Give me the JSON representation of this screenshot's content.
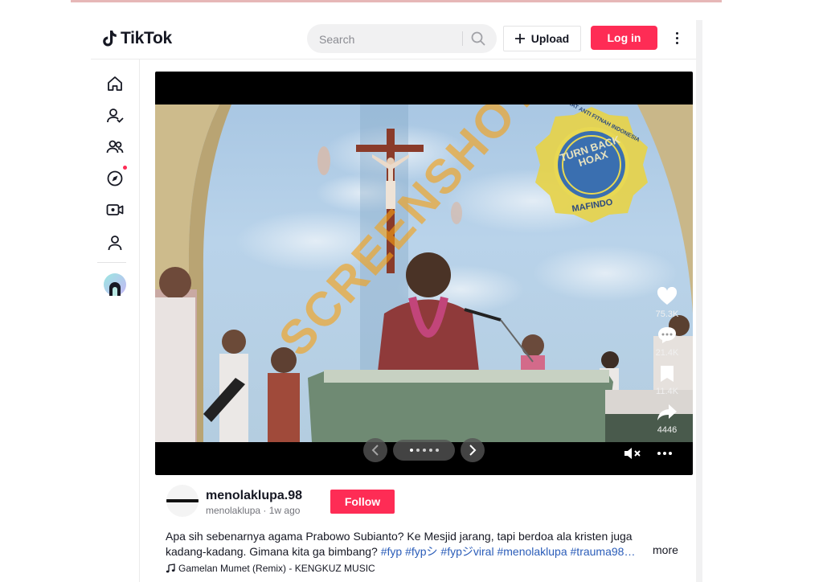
{
  "header": {
    "logo_text": "TikTok",
    "search_placeholder": "Search",
    "upload_label": "Upload",
    "login_label": "Log in"
  },
  "sidebar": {
    "items": [
      {
        "icon": "home-icon"
      },
      {
        "icon": "following-icon"
      },
      {
        "icon": "friends-icon"
      },
      {
        "icon": "explore-icon",
        "notification_dot": true
      },
      {
        "icon": "live-icon"
      },
      {
        "icon": "profile-icon"
      }
    ]
  },
  "video": {
    "watermark_text": "SCREENSHOT BY",
    "stamp": {
      "top": "MASYARAKAT ANTI FITNAH INDONESIA",
      "center": "TURN BACK HOAX",
      "bottom": "MAFINDO"
    },
    "likes": "75.3K",
    "comments": "21.4K",
    "saves": "11.4K",
    "shares": "4446",
    "carousel": {
      "total": 5,
      "current": 1
    }
  },
  "post": {
    "author_name": "menolaklupa.98",
    "author_handle": "menolaklupa",
    "separator": " · ",
    "time_ago": "1w ago",
    "follow_label": "Follow",
    "caption_text": "Apa sih sebenarnya agama Prabowo Subianto? Ke Mesjid jarang, tapi berdoa ala kristen juga kadang-kadang. Gimana kita ga bimbang? ",
    "hashtags": "#fyp #fypシ #fypジviral #menolaklupa #trauma98…",
    "more_label": "more",
    "music": "Gamelan Mumet (Remix) - KENGKUZ MUSIC"
  },
  "colors": {
    "accent": "#fe2c55",
    "hashtag": "#2b5db9",
    "watermark": "#f5a014"
  }
}
